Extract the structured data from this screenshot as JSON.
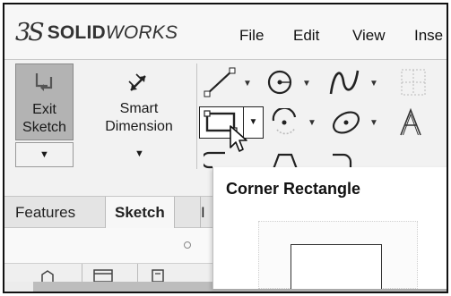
{
  "app": {
    "logo_prefix": "3S",
    "brand_bold": "SOLID",
    "brand_italic": "WORKS"
  },
  "menu": [
    "File",
    "Edit",
    "View",
    "Inse"
  ],
  "command_manager": {
    "exit_sketch": {
      "line1": "Exit",
      "line2": "Sketch",
      "icon": "exit-sketch-icon"
    },
    "smart_dimension": {
      "line1": "Smart",
      "line2": "Dimension",
      "icon": "smart-dimension-icon"
    },
    "tools": [
      "line-icon",
      "circle-icon",
      "spline-icon",
      "grid-icon",
      "corner-rectangle-icon",
      "arc-icon",
      "ellipse-icon",
      "text-icon"
    ]
  },
  "tabs": {
    "features": "Features",
    "sketch": "Sketch",
    "clipped": "I"
  },
  "tooltip": {
    "title": "Corner Rectangle"
  },
  "colors": {
    "selected_button": "#b3b3b3",
    "toolbar_bg": "#f2f2f2",
    "tooltip_bg": "#ffffff"
  }
}
